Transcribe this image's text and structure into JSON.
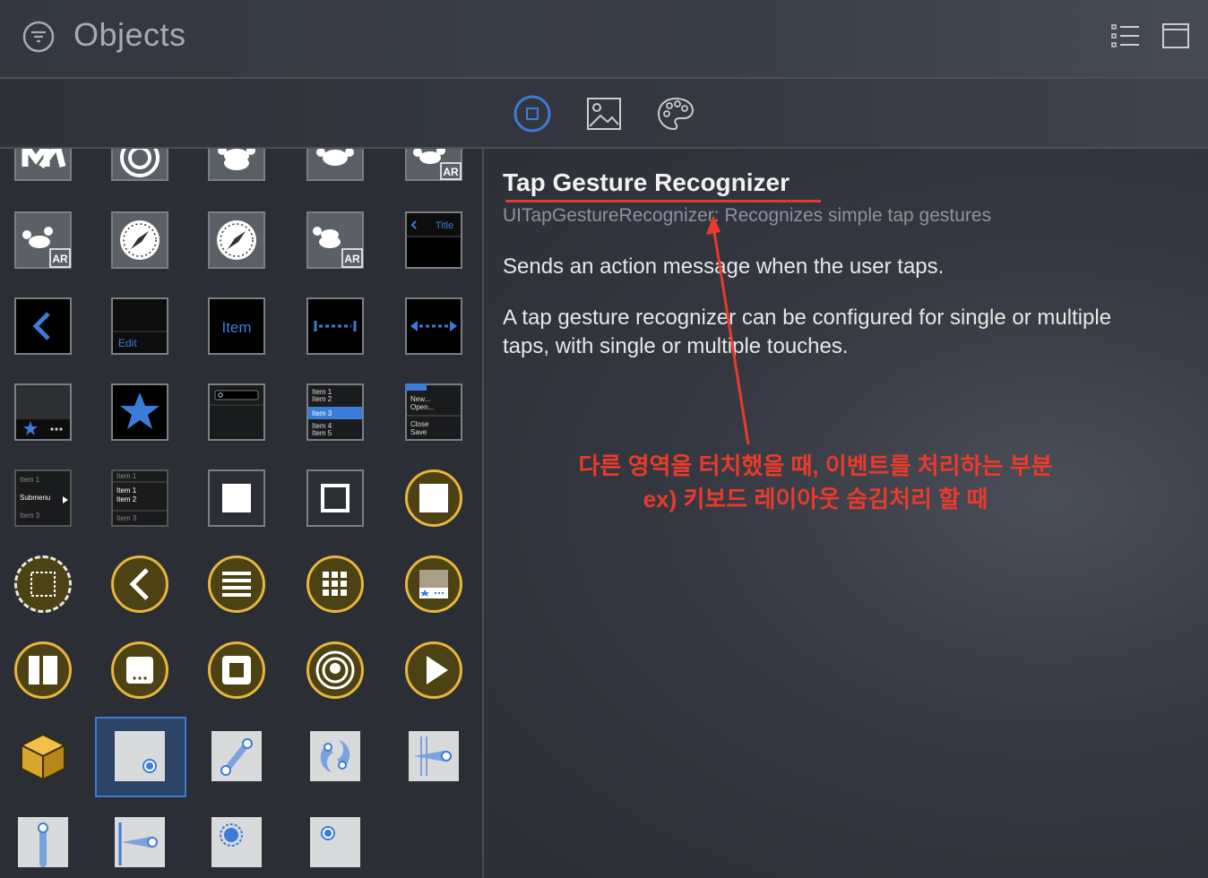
{
  "header": {
    "title": "Objects"
  },
  "tabs": [
    "objects",
    "media",
    "colors"
  ],
  "library": {
    "row1_badges": [
      "AR"
    ],
    "nav_bar_title": "Title",
    "edit_label": "Edit",
    "bar_button_label": "Item",
    "table_items": [
      "Item 1",
      "Item 2",
      "Item 3",
      "Item 4",
      "Item 5"
    ],
    "menu_items": [
      "New...",
      "Open...",
      "Close",
      "Save"
    ],
    "submenu_items": [
      "Item 1",
      "Submenu",
      "Item 3"
    ],
    "menu2_items": [
      "Item 1",
      "Item 1",
      "Item 2",
      "Item 3"
    ],
    "ar_badge": "AR"
  },
  "inspector": {
    "title": "Tap Gesture Recognizer",
    "class_line": "UITapGestureRecognizer: Recognizes simple tap gestures",
    "summary": "Sends an action message when the user taps.",
    "detail": "A tap gesture recognizer can be configured for single or multiple taps, with single or multiple touches."
  },
  "annotation": {
    "line1": "다른 영역을 터치했을 때, 이벤트를 처리하는 부분",
    "line2": "ex) 키보드 레이아웃 숨김처리 할 때"
  },
  "colors": {
    "accent": "#3a7cd8",
    "gold": "#e8b63a",
    "annotation": "#ea3a2b"
  }
}
